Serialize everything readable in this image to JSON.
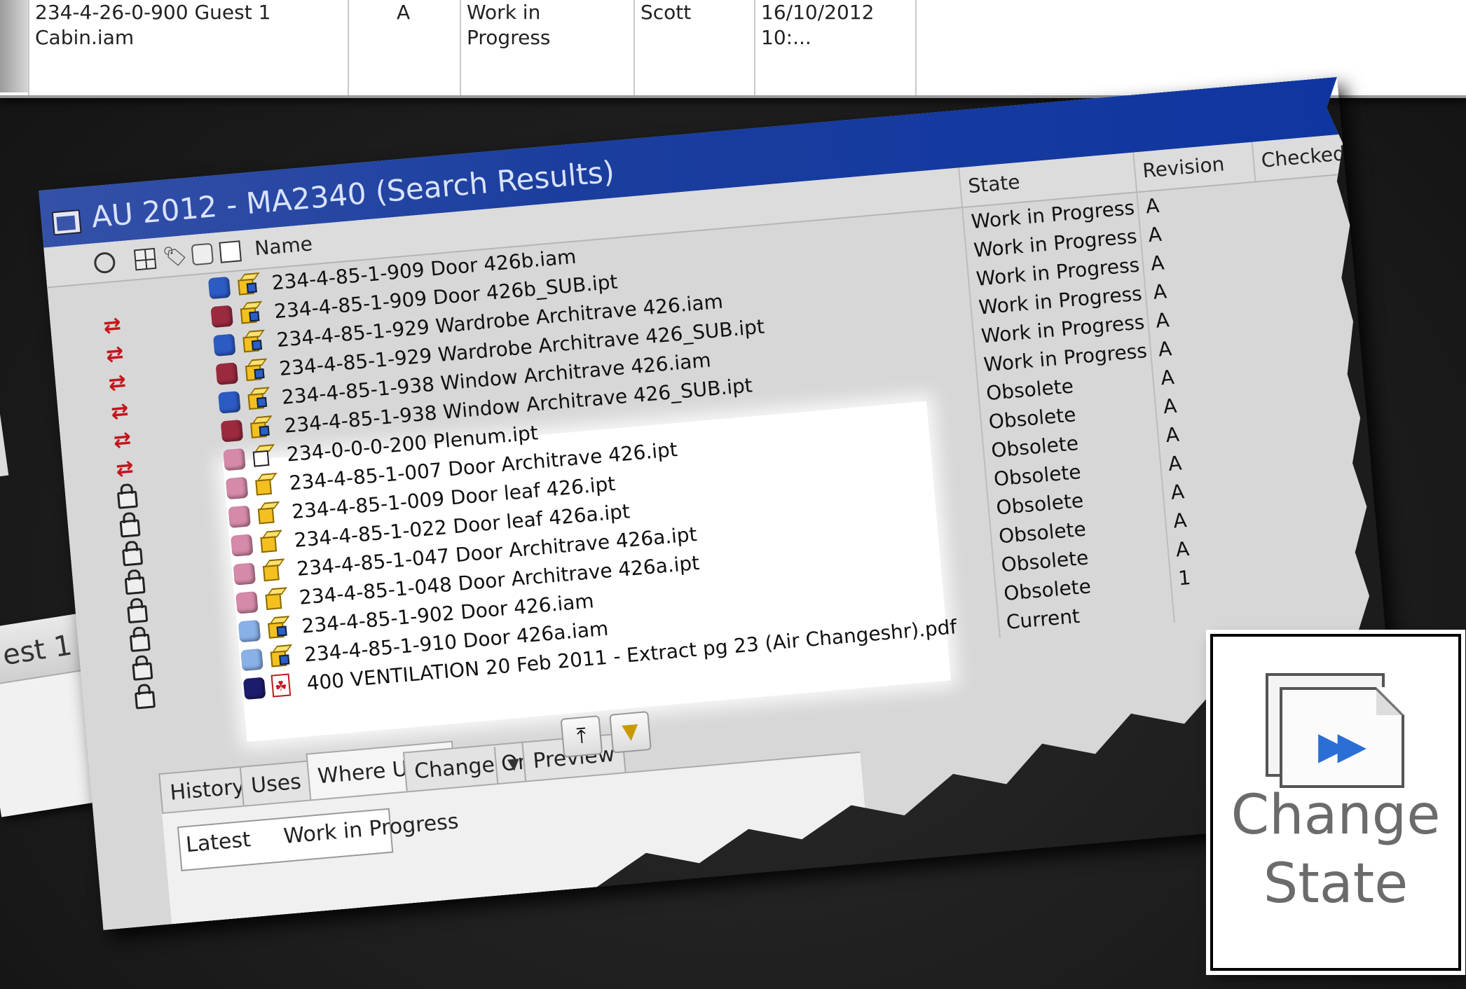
{
  "top_row": {
    "name": "234-4-26-0-900 Guest 1 Cabin.iam",
    "revision": "A",
    "state": "Work in Progress",
    "user": "Scott",
    "date": "16/10/2012 10:..."
  },
  "fragment_text": "est 1",
  "window": {
    "title": "AU 2012 - MA2340   (Search Results)",
    "columns": {
      "name": "Name",
      "state": "State",
      "revision": "Revision",
      "checked": "Checked"
    },
    "rows": [
      {
        "lc": "",
        "dot": "#2c5bc4",
        "ft": "assembly",
        "name": "234-4-85-1-909 Door 426b.iam",
        "state": "Work in Progress",
        "rev": "A"
      },
      {
        "lc": "sync",
        "dot": "#9b2a3f",
        "ft": "part-sub",
        "name": "234-4-85-1-909 Door 426b_SUB.ipt",
        "state": "Work in Progress",
        "rev": "A"
      },
      {
        "lc": "sync",
        "dot": "#2c5bc4",
        "ft": "assembly",
        "name": "234-4-85-1-929 Wardrobe Architrave 426.iam",
        "state": "Work in Progress",
        "rev": "A"
      },
      {
        "lc": "sync",
        "dot": "#9b2a3f",
        "ft": "part-sub",
        "name": "234-4-85-1-929 Wardrobe Architrave 426_SUB.ipt",
        "state": "Work in Progress",
        "rev": "A"
      },
      {
        "lc": "sync",
        "dot": "#2c5bc4",
        "ft": "assembly",
        "name": "234-4-85-1-938 Window Architrave 426.iam",
        "state": "Work in Progress",
        "rev": "A"
      },
      {
        "lc": "sync",
        "dot": "#9b2a3f",
        "ft": "part-sub",
        "name": "234-4-85-1-938 Window Architrave 426_SUB.ipt",
        "state": "Work in Progress",
        "rev": "A"
      },
      {
        "lc": "sync",
        "dot": "#d48aa8",
        "ft": "sheet",
        "name": "234-0-0-0-200 Plenum.ipt",
        "state": "Obsolete",
        "rev": "A"
      },
      {
        "lc": "lock",
        "dot": "#d48aa8",
        "ft": "part",
        "name": "234-4-85-1-007 Door Architrave 426.ipt",
        "state": "Obsolete",
        "rev": "A"
      },
      {
        "lc": "lock",
        "dot": "#d48aa8",
        "ft": "part",
        "name": "234-4-85-1-009 Door leaf 426.ipt",
        "state": "Obsolete",
        "rev": "A"
      },
      {
        "lc": "lock",
        "dot": "#d48aa8",
        "ft": "part",
        "name": "234-4-85-1-022 Door leaf 426a.ipt",
        "state": "Obsolete",
        "rev": "A"
      },
      {
        "lc": "lock",
        "dot": "#d48aa8",
        "ft": "part",
        "name": "234-4-85-1-047 Door Architrave 426a.ipt",
        "state": "Obsolete",
        "rev": "A"
      },
      {
        "lc": "lock",
        "dot": "#d48aa8",
        "ft": "part",
        "name": "234-4-85-1-048 Door Architrave 426a.ipt",
        "state": "Obsolete",
        "rev": "A"
      },
      {
        "lc": "lock",
        "dot": "#8ab0e8",
        "ft": "assembly",
        "name": "234-4-85-1-902 Door 426.iam",
        "state": "Obsolete",
        "rev": "A"
      },
      {
        "lc": "lock",
        "dot": "#8ab0e8",
        "ft": "assembly",
        "name": "234-4-85-1-910 Door 426a.iam",
        "state": "Obsolete",
        "rev": "1"
      },
      {
        "lc": "lock",
        "dot": "#1c1c6e",
        "ft": "pdf",
        "name": "400 VENTILATION 20 Feb 2011 - Extract pg 23 (Air Changeshr).pdf",
        "state": "Current",
        "rev": ""
      }
    ],
    "tabs": [
      "History",
      "Uses",
      "Where Used",
      "Change Order",
      "Preview"
    ],
    "active_tab": "Where Used",
    "panel": {
      "version": "Latest",
      "state": "Work in Progress"
    }
  },
  "callout": {
    "line1": "Change",
    "line2": "State",
    "icon": "change-state-icon",
    "text_color": "#6b6b6b",
    "arrow_color": "#2b6fd6"
  },
  "colors": {
    "titlebar": "#1b3e9e",
    "sync_icon": "#c4161c",
    "highlight": "#ffffff"
  }
}
